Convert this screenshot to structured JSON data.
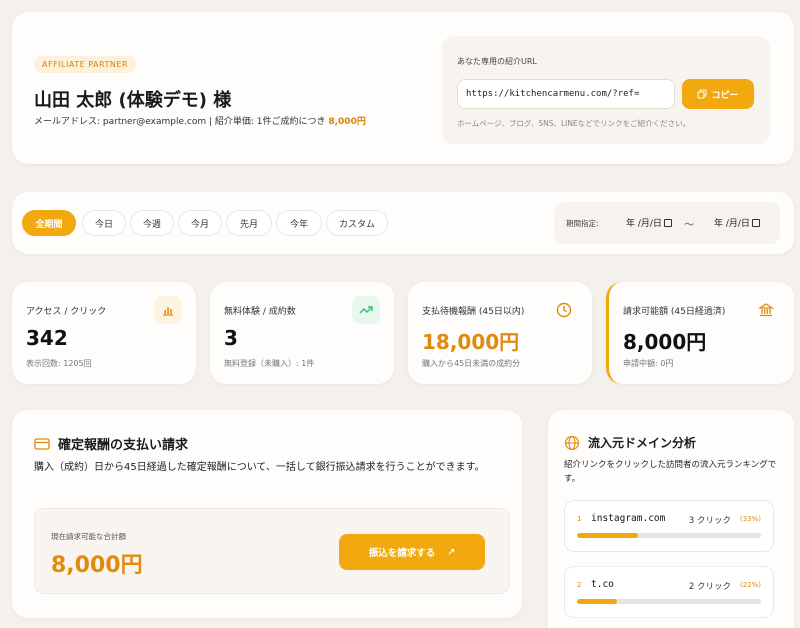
{
  "header": {
    "badge": "AFFILIATE PARTNER",
    "name": "山田 太郎 (体験デモ) 様",
    "meta_prefix": "メールアドレス: partner@example.com | 紹介単価: 1件ご成約につき ",
    "meta_price": "8,000円",
    "url_title": "あなた専用の紹介URL",
    "url_value": "https://kitchencarmenu.com/?ref=",
    "copy_label": "コピー",
    "url_help": "ホームページ、ブログ、SNS、LINEなどでリンクをご紹介ください。"
  },
  "filters": {
    "tabs": [
      "全期間",
      "今日",
      "今週",
      "今月",
      "先月",
      "今年",
      "カスタム"
    ],
    "active": "全期間",
    "period_label": "期間指定:",
    "date_from": "年 /月/日",
    "date_to": "年 /月/日",
    "tilde": "〜"
  },
  "stats": [
    {
      "label": "アクセス / クリック",
      "value": "342",
      "sub": "表示回数: 1205回",
      "icon": "bar-chart-icon"
    },
    {
      "label": "無料体験 / 成約数",
      "value": "3",
      "sub": "無料登録（未購入）: 1件",
      "icon": "trending-up-icon"
    },
    {
      "label": "支払待機報酬 (45日以内)",
      "value": "18,000円",
      "sub": "購入から45日未満の成約分",
      "icon": "clock-icon"
    },
    {
      "label": "請求可能額 (45日経過済)",
      "value": "8,000円",
      "sub": "申請中額: 0円",
      "icon": "bank-icon"
    }
  ],
  "payout": {
    "title": "確定報酬の支払い請求",
    "desc": "購入（成約）日から45日経過した確定報酬について、一括して銀行振込請求を行うことができます。",
    "avail_label": "現在請求可能な合計額",
    "avail_value": "8,000円",
    "button": "振込を請求する",
    "button_arrow": "↗"
  },
  "domains": {
    "title": "流入元ドメイン分析",
    "desc": "紹介リンクをクリックした訪問者の流入元ランキングです。",
    "items": [
      {
        "rank": "1",
        "name": "instagram.com",
        "clicks": "3 クリック",
        "pct": "(33%)",
        "share": 33
      },
      {
        "rank": "2",
        "name": "t.co",
        "clicks": "2 クリック",
        "pct": "(22%)",
        "share": 22
      }
    ]
  },
  "colors": {
    "accent": "#f2a80f",
    "accent_text": "#e08b0c",
    "green": "#2fbf71"
  }
}
